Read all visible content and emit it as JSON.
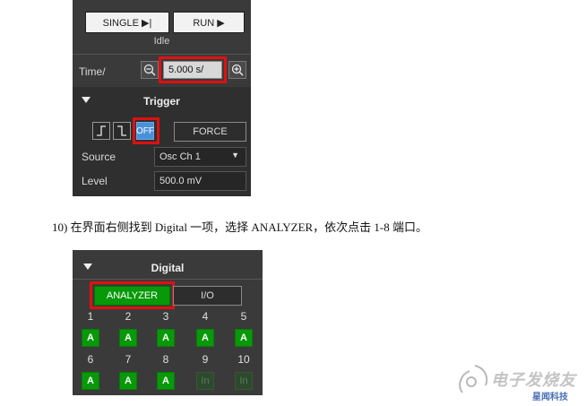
{
  "top_panel": {
    "single_label": "SINGLE ▶|",
    "run_label": "RUN ▶",
    "status": "Idle",
    "time_label": "Time/",
    "time_value": "5.000 s/",
    "trigger_title": "Trigger",
    "off_label": "OFF",
    "force_label": "FORCE",
    "source_label": "Source",
    "source_value": "Osc Ch 1",
    "level_label": "Level",
    "level_value": "500.0 mV"
  },
  "step_text": "10) 在界面右侧找到 Digital 一项，选择 ANALYZER，依次点击 1-8 端口。",
  "digital_panel": {
    "title": "Digital",
    "analyzer_label": "ANALYZER",
    "io_label": "I/O",
    "row1_numbers": [
      "1",
      "2",
      "3",
      "4",
      "5"
    ],
    "row1_cells": [
      "A",
      "A",
      "A",
      "A",
      "A"
    ],
    "row2_numbers": [
      "6",
      "7",
      "8",
      "9",
      "10"
    ],
    "row2_cells": [
      "A",
      "A",
      "A",
      "In",
      "In"
    ]
  },
  "watermark": {
    "main": "电子发烧友",
    "sub": "星闻科技"
  },
  "colors": {
    "panel_bg": "#3a3a3a",
    "highlight_red": "#e01010",
    "analyzer_green": "#079907",
    "off_blue": "#4a90d9"
  }
}
